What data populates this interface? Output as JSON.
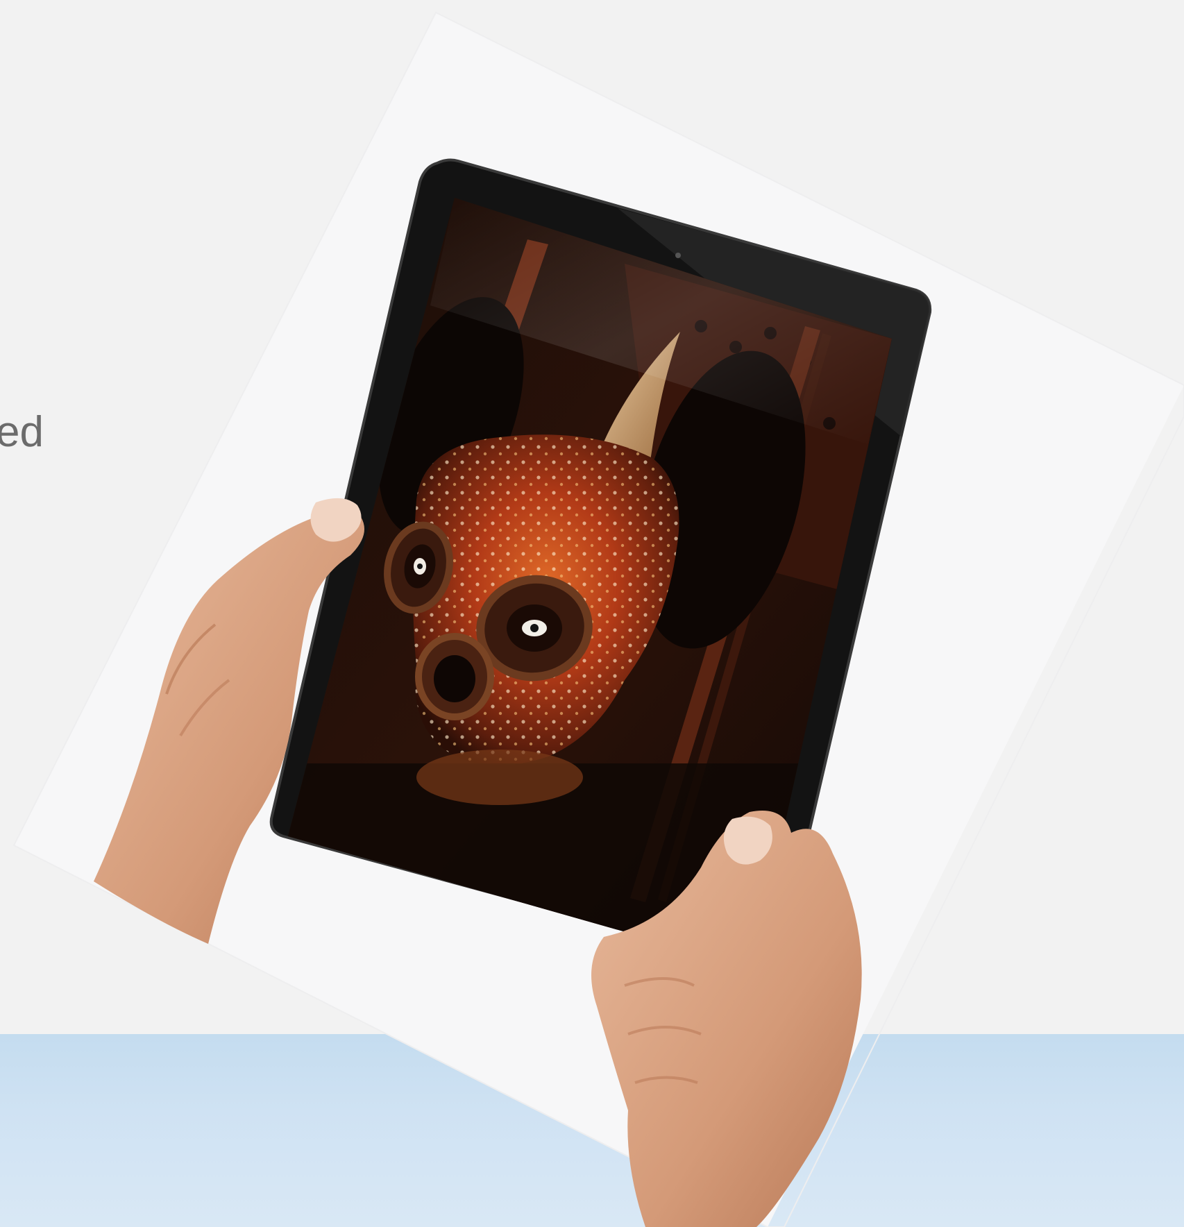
{
  "page": {
    "background_color": "#f2f2f2",
    "band_color": "#c9deef",
    "cropped_text": "ed"
  },
  "image": {
    "subject": "hands-holding-tablet",
    "screen_content": "ornate-mask"
  }
}
